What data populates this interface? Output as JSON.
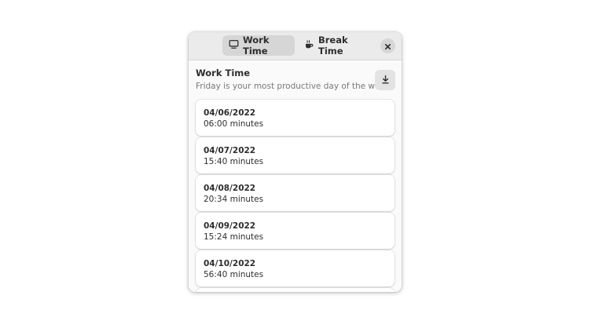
{
  "header": {
    "tabs": [
      {
        "label": "Work Time",
        "icon": "monitor-icon",
        "active": true
      },
      {
        "label": "Break Time",
        "icon": "coffee-icon",
        "active": false
      }
    ],
    "close_icon": "close-icon"
  },
  "main": {
    "title": "Work Time",
    "subtitle": "Friday is your most productive day of the week",
    "download_icon": "download-icon",
    "entries": [
      {
        "date": "04/06/2022",
        "duration": "06:00 minutes"
      },
      {
        "date": "04/07/2022",
        "duration": "15:40 minutes"
      },
      {
        "date": "04/08/2022",
        "duration": "20:34 minutes"
      },
      {
        "date": "04/09/2022",
        "duration": "15:24 minutes"
      },
      {
        "date": "04/10/2022",
        "duration": "56:40 minutes"
      },
      {
        "date": "",
        "duration": ""
      }
    ]
  },
  "colors": {
    "headerbar": "#ebebeb",
    "window": "#fafafa",
    "active_tab": "#d6d6d6",
    "text": "#2e2e2e",
    "subtitle": "#7a7a7a"
  }
}
